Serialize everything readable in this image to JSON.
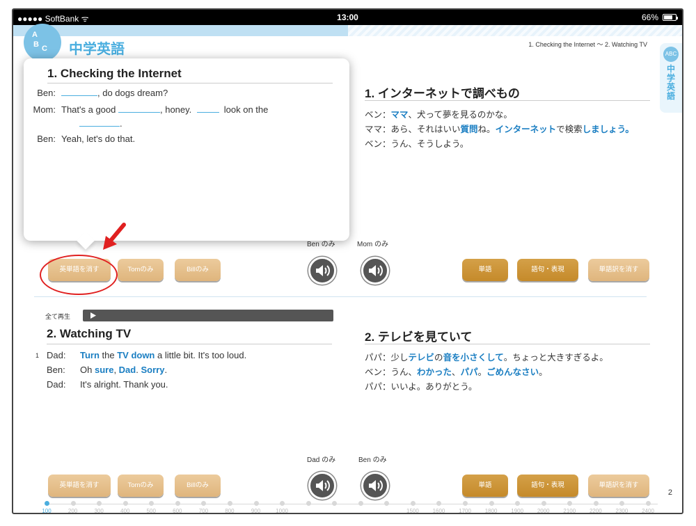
{
  "status_bar": {
    "carrier": "●●●●● SoftBank ᯤ",
    "time": "13:00",
    "battery": "66%"
  },
  "app": {
    "title": "中学英語",
    "logo_letters": [
      "A",
      "B",
      "C"
    ],
    "breadcrumb": "1. Checking the Internet ～ 2. Watching TV",
    "side_tab_label": "中学英語",
    "reading_progress": 0.5
  },
  "section1_jp": {
    "title": "1. インターネットで調べもの",
    "lines": [
      {
        "speaker": "ベン：",
        "parts": [
          {
            "t": "ママ",
            "hl": true
          },
          {
            "t": "、犬って夢を見るのかな。",
            "hl": false
          }
        ]
      },
      {
        "speaker": "ママ：",
        "parts": [
          {
            "t": "あら、それはいい",
            "hl": false
          },
          {
            "t": "質問",
            "hl": true
          },
          {
            "t": "ね。",
            "hl": false
          },
          {
            "t": "インターネット",
            "hl": true
          },
          {
            "t": "で検索",
            "hl": false
          },
          {
            "t": "しましょう。",
            "hl": true
          }
        ]
      },
      {
        "speaker": "ベン：",
        "parts": [
          {
            "t": "うん、そうしよう。",
            "hl": false
          }
        ]
      }
    ]
  },
  "popup": {
    "title": "1. Checking the Internet",
    "line1_speaker": "Ben:",
    "line1_text": ", do dogs dream?",
    "line2_speaker": "Mom:",
    "line2_text_a": "That's a good",
    "line2_text_b": ", honey.",
    "line2_text_c": "look on the",
    "line2_text_d": ".",
    "line3_speaker": "Ben:",
    "line3_text": "Yeah, let's do that."
  },
  "toolbar1": {
    "erase_english": "英単語を消す",
    "tom_only": "Tomのみ",
    "bill_only": "Billのみ",
    "speaker_left_label": "Ben のみ",
    "speaker_right_label": "Mom のみ",
    "words": "単語",
    "phrases": "語句・表現",
    "erase_word_trans": "単語訳を消す"
  },
  "play_all": {
    "label": "全て再生"
  },
  "section2_en": {
    "title": "2. Watching TV",
    "line_number": "1",
    "lines": [
      {
        "speaker": "Dad:",
        "parts": [
          {
            "t": "Turn",
            "hl": true
          },
          {
            "t": " the ",
            "hl": false
          },
          {
            "t": "TV down",
            "hl": true
          },
          {
            "t": " a little bit.  It's too loud.",
            "hl": false
          }
        ]
      },
      {
        "speaker": "Ben:",
        "parts": [
          {
            "t": "Oh ",
            "hl": false
          },
          {
            "t": "sure",
            "hl": true
          },
          {
            "t": ", ",
            "hl": false
          },
          {
            "t": "Dad",
            "hl": true
          },
          {
            "t": ".  ",
            "hl": false
          },
          {
            "t": "Sorry",
            "hl": true
          },
          {
            "t": ".",
            "hl": false
          }
        ]
      },
      {
        "speaker": "Dad:",
        "parts": [
          {
            "t": "It's alright.  Thank you.",
            "hl": false
          }
        ]
      }
    ]
  },
  "section2_jp": {
    "title": "2. テレビを見ていて",
    "lines": [
      {
        "speaker": "パパ：",
        "parts": [
          {
            "t": "少し",
            "hl": false
          },
          {
            "t": "テレビ",
            "hl": true
          },
          {
            "t": "の",
            "hl": false
          },
          {
            "t": "音を小さくして",
            "hl": true
          },
          {
            "t": "。ちょっと大きすぎるよ。",
            "hl": false
          }
        ]
      },
      {
        "speaker": "ベン：",
        "parts": [
          {
            "t": "うん、",
            "hl": false
          },
          {
            "t": "わかった",
            "hl": true
          },
          {
            "t": "、",
            "hl": false
          },
          {
            "t": "パパ",
            "hl": true
          },
          {
            "t": "。",
            "hl": false
          },
          {
            "t": "ごめんなさい",
            "hl": true
          },
          {
            "t": "。",
            "hl": false
          }
        ]
      },
      {
        "speaker": "パパ：",
        "parts": [
          {
            "t": "いいよ。ありがとう。",
            "hl": false
          }
        ]
      }
    ]
  },
  "toolbar2": {
    "erase_english": "英単語を消す",
    "tom_only": "Tomのみ",
    "bill_only": "Billのみ",
    "speaker_left_label": "Dad のみ",
    "speaker_right_label": "Ben のみ",
    "words": "単語",
    "phrases": "語句・表現",
    "erase_word_trans": "単語訳を消す"
  },
  "page_number": "2",
  "timeline": {
    "labels": [
      "100",
      "200",
      "300",
      "400",
      "500",
      "600",
      "700",
      "800",
      "900",
      "1000",
      "",
      "",
      "",
      "",
      "1500",
      "1600",
      "1700",
      "1800",
      "1900",
      "2000",
      "2100",
      "2200",
      "2300",
      "2400"
    ],
    "active_index": 0
  },
  "colors": {
    "accent_blue": "#4aaedf",
    "highlight_blue": "#1a7ec2",
    "button_light": "#e3bc86",
    "button_dark": "#c8902f",
    "annotation_red": "#e02020"
  }
}
